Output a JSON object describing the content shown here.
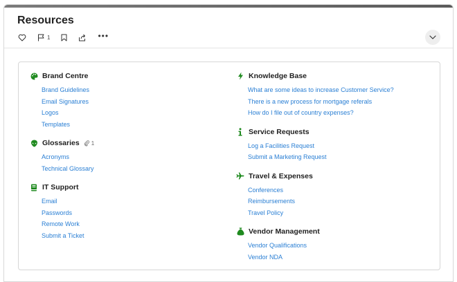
{
  "page": {
    "title": "Resources"
  },
  "actions": {
    "flag_count": "1",
    "more_label": "•••"
  },
  "colors": {
    "accent_green": "#1f8a1f",
    "link_blue": "#2a7fd4"
  },
  "left_sections": [
    {
      "title": "Brand Centre",
      "icon": "palette-icon",
      "links": [
        "Brand Guidelines",
        "Email Signatures",
        "Logos",
        "Templates"
      ]
    },
    {
      "title": "Glossaries",
      "icon": "alien-icon",
      "attachment_count": "1",
      "links": [
        "Acronyms",
        "Technical Glossary"
      ]
    },
    {
      "title": "IT Support",
      "icon": "book-icon",
      "links": [
        "Email",
        "Passwords",
        "Remote Work",
        "Submit a Ticket"
      ]
    }
  ],
  "right_sections": [
    {
      "title": "Knowledge Base",
      "icon": "lightning-icon",
      "links": [
        "What are some ideas to increase Customer Service?",
        "There is a new process for mortgage referals",
        "How do I file out of country expenses?"
      ]
    },
    {
      "title": "Service Requests",
      "icon": "info-icon",
      "links": [
        "Log a Facilities Request",
        "Submit a Marketing Request"
      ]
    },
    {
      "title": "Travel & Expenses",
      "icon": "plane-icon",
      "links": [
        "Conferences",
        "Reimbursements",
        "Travel Policy"
      ]
    },
    {
      "title": "Vendor Management",
      "icon": "money-bag-icon",
      "links": [
        "Vendor Qualifications",
        "Vendor NDA"
      ]
    }
  ]
}
